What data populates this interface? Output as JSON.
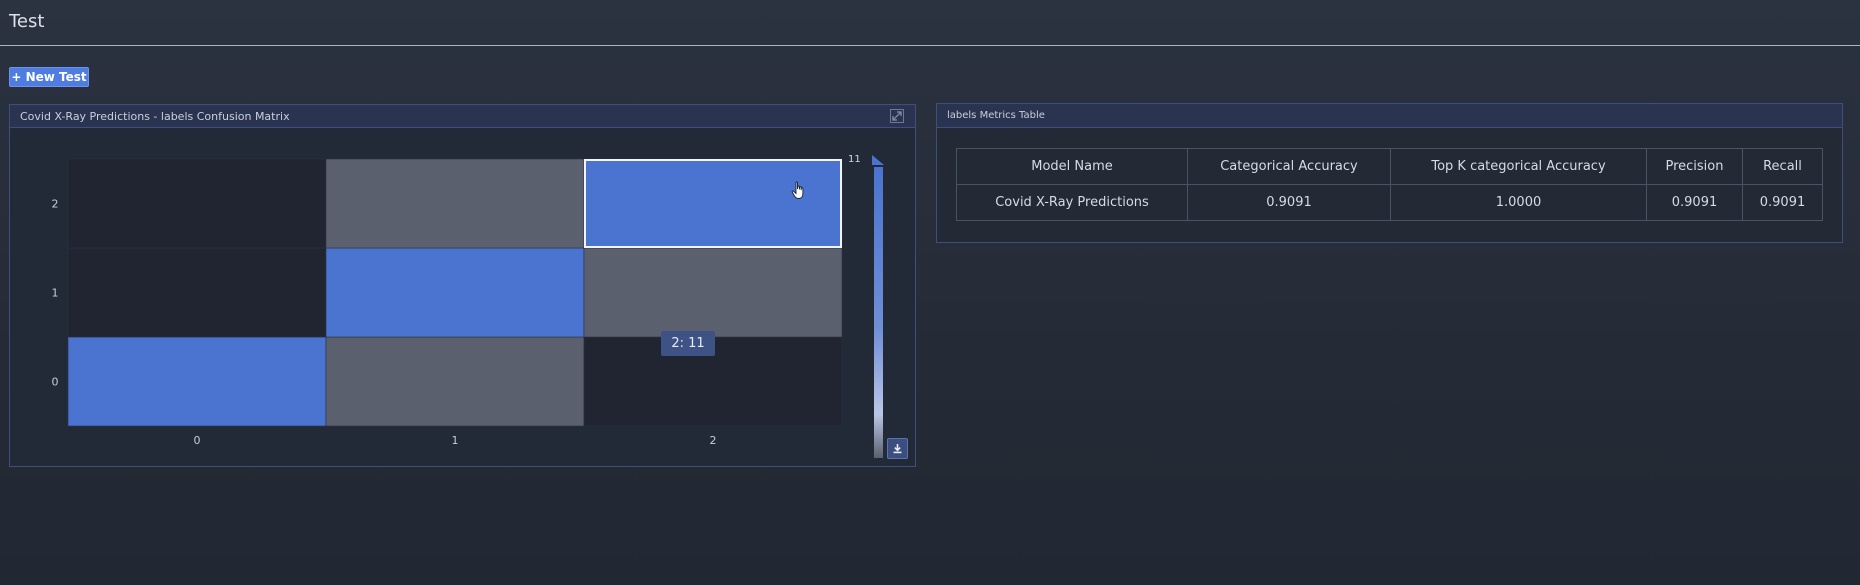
{
  "header": {
    "title": "Test"
  },
  "toolbar": {
    "new_test_label": "+ New Test"
  },
  "confusion_panel": {
    "title": "Covid X-Ray Predictions - labels Confusion Matrix",
    "tooltip": "2: 11"
  },
  "metrics_panel": {
    "title": "labels Metrics Table",
    "columns": [
      "Model Name",
      "Categorical Accuracy",
      "Top K categorical Accuracy",
      "Precision",
      "Recall"
    ],
    "rows": [
      [
        "Covid X-Ray Predictions",
        "0.9091",
        "1.0000",
        "0.9091",
        "0.9091"
      ]
    ]
  },
  "colors": {
    "high": "#4a74d0",
    "mid": "#5a606e",
    "low": "#202531",
    "accent": "#4f7ce0"
  },
  "chart_data": {
    "type": "heatmap",
    "x_categories": [
      "0",
      "1",
      "2"
    ],
    "y_categories": [
      "0",
      "1",
      "2"
    ],
    "matrix_levels": [
      [
        "high",
        "mid",
        "low"
      ],
      [
        "low",
        "high",
        "mid"
      ],
      [
        "low",
        "mid",
        "high"
      ]
    ],
    "colorbar_max": "11",
    "highlighted_cell": {
      "row": "2",
      "col": "2",
      "value": 11
    }
  }
}
